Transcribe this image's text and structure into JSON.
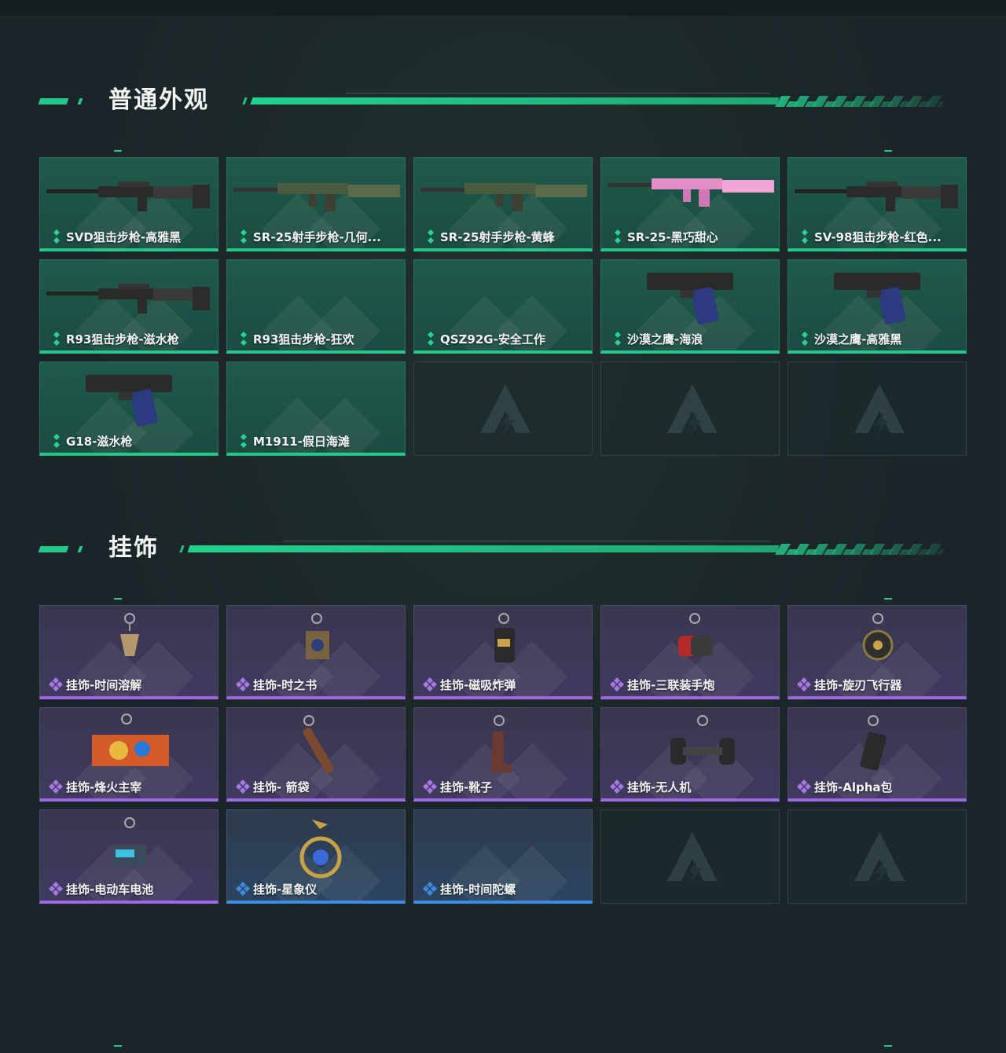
{
  "sections": {
    "skins": {
      "title": "普通外观",
      "items": [
        {
          "label": "SVD狙击步枪-高雅黑",
          "icon": "sniper-rifle-icon",
          "rarity": "green"
        },
        {
          "label": "SR-25射手步枪-几何...",
          "icon": "marksman-rifle-icon",
          "rarity": "green"
        },
        {
          "label": "SR-25射手步枪-黄蜂",
          "icon": "marksman-rifle-icon",
          "rarity": "green"
        },
        {
          "label": "SR-25-黑巧甜心",
          "icon": "rifle-icon",
          "rarity": "green"
        },
        {
          "label": "SV-98狙击步枪-红色...",
          "icon": "sniper-rifle-icon",
          "rarity": "green"
        },
        {
          "label": "R93狙击步枪-滋水枪",
          "icon": "sniper-rifle-icon",
          "rarity": "green"
        },
        {
          "label": "R93狙击步枪-狂欢",
          "icon": "",
          "rarity": "green"
        },
        {
          "label": "QSZ92G-安全工作",
          "icon": "",
          "rarity": "green"
        },
        {
          "label": "沙漠之鹰-海浪",
          "icon": "pistol-icon",
          "rarity": "green"
        },
        {
          "label": "沙漠之鹰-高雅黑",
          "icon": "pistol-icon",
          "rarity": "green"
        },
        {
          "label": "G18-滋水枪",
          "icon": "pistol-icon",
          "rarity": "green"
        },
        {
          "label": "M1911-假日海滩",
          "icon": "",
          "rarity": "green"
        }
      ],
      "empty_slots": 3
    },
    "charms": {
      "title": "挂饰",
      "items": [
        {
          "label": "挂饰-时间溶解",
          "icon": "charm-icon",
          "rarity": "purple"
        },
        {
          "label": "挂饰-时之书",
          "icon": "book-charm-icon",
          "rarity": "purple"
        },
        {
          "label": "挂饰-磁吸炸弹",
          "icon": "bomb-charm-icon",
          "rarity": "purple"
        },
        {
          "label": "挂饰-三联装手炮",
          "icon": "cannon-charm-icon",
          "rarity": "purple"
        },
        {
          "label": "挂饰-旋刃飞行器",
          "icon": "blade-charm-icon",
          "rarity": "purple"
        },
        {
          "label": "挂饰-烽火主宰",
          "icon": "container-charm-icon",
          "rarity": "purple"
        },
        {
          "label": "挂饰- 箭袋",
          "icon": "quiver-charm-icon",
          "rarity": "purple"
        },
        {
          "label": "挂饰-靴子",
          "icon": "boot-charm-icon",
          "rarity": "purple"
        },
        {
          "label": "挂饰-无人机",
          "icon": "drone-charm-icon",
          "rarity": "purple"
        },
        {
          "label": "挂饰-Alpha包",
          "icon": "bag-charm-icon",
          "rarity": "purple"
        },
        {
          "label": "挂饰-电动车电池",
          "icon": "battery-charm-icon",
          "rarity": "purple"
        },
        {
          "label": "挂饰-星象仪",
          "icon": "astrolabe-charm-icon",
          "rarity": "blue"
        },
        {
          "label": "挂饰-时间陀螺",
          "icon": "",
          "rarity": "blue"
        }
      ],
      "empty_slots": 2
    }
  },
  "colors": {
    "accent_green": "#22c88a",
    "rarity_green": "#25c689",
    "rarity_purple": "#9b6ae0",
    "rarity_blue": "#3e8ce0"
  }
}
